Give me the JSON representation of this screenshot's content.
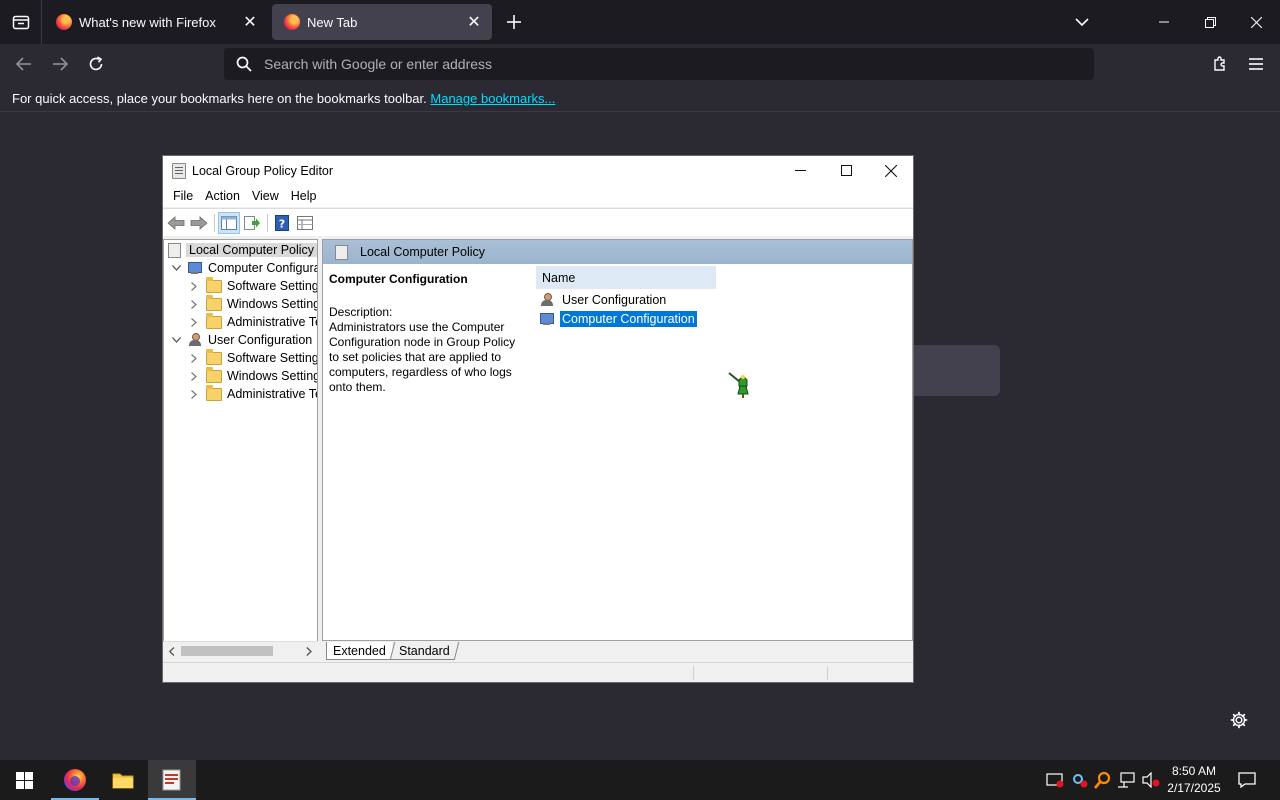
{
  "browser": {
    "tabs": [
      {
        "label": "What's new with Firefox",
        "active": false
      },
      {
        "label": "New Tab",
        "active": true
      }
    ],
    "urlbar": {
      "placeholder": "Search with Google or enter address",
      "value": ""
    },
    "bookmarks_bar": {
      "message": "For quick access, place your bookmarks here on the bookmarks toolbar.",
      "link": "Manage bookmarks..."
    },
    "accent": "#00ddff"
  },
  "gpedit": {
    "title": "Local Group Policy Editor",
    "menu": [
      "File",
      "Action",
      "View",
      "Help"
    ],
    "tree": {
      "root": "Local Computer Policy",
      "computer_configuration": "Computer Configura",
      "computer_children": [
        "Software Settings",
        "Windows Setting",
        "Administrative Te"
      ],
      "user_configuration": "User Configuration",
      "user_children": [
        "Software Settings",
        "Windows Setting",
        "Administrative Te"
      ]
    },
    "right_pane": {
      "header": "Local Computer Policy",
      "description_title": "Computer Configuration",
      "description_label": "Description:",
      "description_text": "Administrators use the Computer Configuration node in Group Policy to set policies that are applied to computers, regardless of who logs onto them.",
      "list_header": "Name",
      "items": [
        {
          "label": "User Configuration",
          "selected": false,
          "icon": "user-config-icon"
        },
        {
          "label": "Computer Configuration",
          "selected": true,
          "icon": "computer-config-icon"
        }
      ]
    },
    "view_tabs": [
      "Extended",
      "Standard"
    ],
    "selection_color": "#0078d7"
  },
  "taskbar": {
    "clock_time": "8:50 AM",
    "clock_date": "2/17/2025"
  }
}
